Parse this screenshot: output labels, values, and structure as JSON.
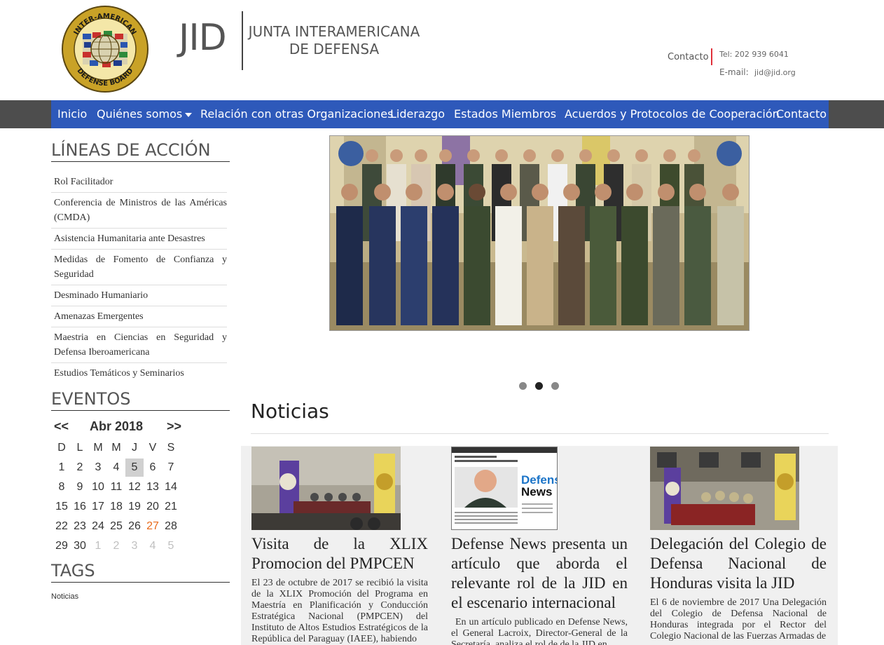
{
  "header": {
    "seal_alt": "INTER-AMERICAN DEFENSE BOARD",
    "logo_text": "JID",
    "org_name_line1": "JUNTA INTERAMERICANA",
    "org_name_line2": "DE DEFENSA",
    "contact_label": "Contacto",
    "tel": "Tel: 202 939 6041",
    "email_label": "E-mail:",
    "email": "jid@jid.org",
    "accent_color": "#e0303a"
  },
  "nav": {
    "bar_color": "#2e59ba",
    "items": [
      {
        "label": "Inicio"
      },
      {
        "label": "Quiénes somos",
        "dropdown": true
      },
      {
        "label": "Relación con otras Organizaciones"
      },
      {
        "label": "Liderazgo"
      },
      {
        "label": "Estados Miembros"
      },
      {
        "label": "Acuerdos y Protocolos de Cooperación"
      },
      {
        "label": "Contacto"
      }
    ]
  },
  "sidebar": {
    "lineas_heading": "LÍNEAS DE ACCIÓN",
    "lineas": [
      "Rol Facilitador",
      "Conferencia de Ministros de las Américas (CMDA)",
      "Asistencia Humanitaria ante Desastres",
      "Medidas de Fomento de Confianza y Seguridad",
      "Desminado Humaniario",
      "Amenazas Emergentes",
      "Maestria en Ciencias en Seguridad y Defensa Iberoamericana",
      "Estudios Temáticos y Seminarios"
    ],
    "eventos_heading": "EVENTOS",
    "calendar": {
      "prev": "<<",
      "title": "Abr 2018",
      "next": ">>",
      "dow": [
        "D",
        "L",
        "M",
        "M",
        "J",
        "V",
        "S"
      ],
      "weeks": [
        [
          "1",
          "2",
          "3",
          "4",
          "5",
          "6",
          "7"
        ],
        [
          "8",
          "9",
          "10",
          "11",
          "12",
          "13",
          "14"
        ],
        [
          "15",
          "16",
          "17",
          "18",
          "19",
          "20",
          "21"
        ],
        [
          "22",
          "23",
          "24",
          "25",
          "26",
          "27",
          "28"
        ],
        [
          "29",
          "30",
          "1",
          "2",
          "3",
          "4",
          "5"
        ]
      ],
      "today": "5",
      "event_day": "27",
      "event_color": "#e86a1a"
    },
    "tags_heading": "TAGS",
    "tags": [
      "Noticias"
    ]
  },
  "carousel": {
    "slide_count": 3,
    "active_slide": 2
  },
  "news": {
    "heading": "Noticias",
    "items": [
      {
        "title": "Visita de la XLIX Promocion del PMPCEN",
        "body": "El 23 de octubre de 2017 se recibió la visita de la XLIX Promoción del Programa en Maestría en Planificación y Conducción Estratégica Nacional (PMPCEN) del Instituto de Altos Estudios Estratégicos de la República del Paraguay (IAEE), habiendo"
      },
      {
        "title": "Defense News presenta un artículo que aborda el relevante rol de la JID en el escenario internacional",
        "body": "En un artículo publicado en Defense News, el General Lacroix, Director-General de la Secretaría, analiza el rol de de la JID en",
        "thumb_brand_line1": "Defense",
        "thumb_brand_line2": "News"
      },
      {
        "title": "Delegación del Colegio de Defensa Nacional de Honduras visita la JID",
        "body": "El 6 de noviembre de 2017 Una Delegación del Colegio de Defensa Nacional de Honduras integrada por el Rector del Colegio Nacional de las Fuerzas Armadas de"
      }
    ]
  }
}
